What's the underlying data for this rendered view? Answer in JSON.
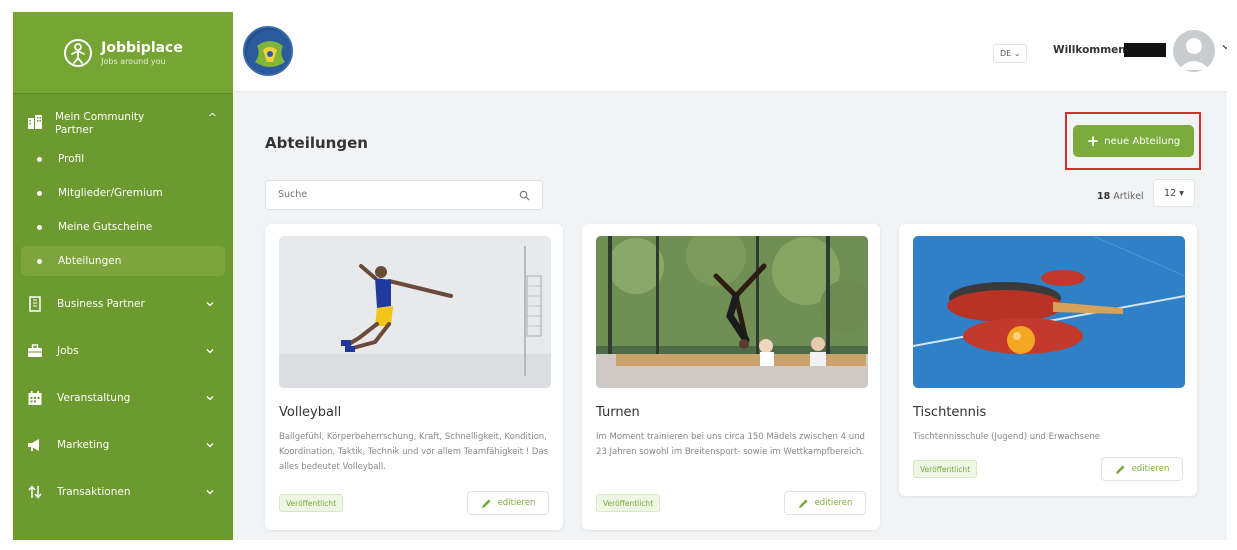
{
  "app": {
    "logo_title": "Jobbiplace",
    "logo_subtitle": "Jobs around you"
  },
  "sidebar": {
    "section": {
      "label_line1": "Mein Community",
      "label_line2": "Partner"
    },
    "sub_items": [
      {
        "label": "Profil"
      },
      {
        "label": "Mitglieder/Gremium"
      },
      {
        "label": "Meine Gutscheine"
      },
      {
        "label": "Abteilungen",
        "active": true
      }
    ],
    "items": [
      {
        "label": "Business Partner",
        "icon": "building-icon"
      },
      {
        "label": "Jobs",
        "icon": "briefcase-icon"
      },
      {
        "label": "Veranstaltung",
        "icon": "calendar-icon"
      },
      {
        "label": "Marketing",
        "icon": "megaphone-icon"
      },
      {
        "label": "Transaktionen",
        "icon": "arrows-updown-icon"
      }
    ]
  },
  "topbar": {
    "language": "DE ⌄",
    "welcome": "Willkommen,"
  },
  "main": {
    "title": "Abteilungen",
    "new_button": "neue Abteilung",
    "search_placeholder": "Suche",
    "count_number": "18",
    "count_label": "Artikel",
    "per_page": "12 ▾",
    "cards": [
      {
        "title": "Volleyball",
        "description": "Ballgefühl, Körperbeherrschung, Kraft, Schnelligkeit, Kondition, Koordination, Taktik, Technik und vor allem Teamfähigkeit ! Das alles bedeutet Volleyball.",
        "status": "Veröffentlicht",
        "edit_label": "editieren"
      },
      {
        "title": "Turnen",
        "description": "Im Moment trainieren bei uns circa 150 Mädels zwischen 4 und 23 Jahren sowohl im Breitensport- sowie im Wettkampfbereich.",
        "status": "Veröffentlicht",
        "edit_label": "editieren"
      },
      {
        "title": "Tischtennis",
        "description": "Tischtennisschule (Jugend) und Erwachsene",
        "status": "Veröffentlicht",
        "edit_label": "editieren"
      }
    ]
  },
  "colors": {
    "sidebar": "#6c9a2e",
    "accent": "#7bab3c",
    "highlight": "#d32f2f"
  }
}
